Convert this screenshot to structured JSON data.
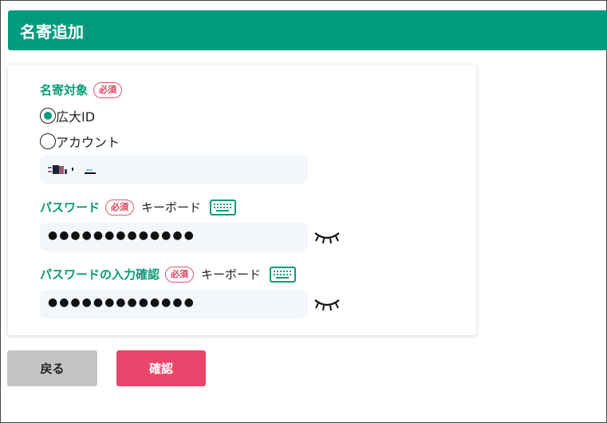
{
  "header": {
    "title": "名寄追加"
  },
  "target": {
    "label": "名寄対象",
    "required": "必須",
    "options": [
      {
        "label": "広大ID",
        "checked": true
      },
      {
        "label": "アカウント",
        "checked": false
      }
    ]
  },
  "password": {
    "label": "パスワード",
    "required": "必須",
    "keyboard_label": "キーボード",
    "masked_value": "●●●●●●●●●●●●●"
  },
  "password_confirm": {
    "label": "パスワードの入力確認",
    "required": "必須",
    "keyboard_label": "キーボード",
    "masked_value": "●●●●●●●●●●●●●"
  },
  "buttons": {
    "back": "戻る",
    "confirm": "確認"
  },
  "colors": {
    "accent": "#009b7d",
    "required": "#e0405c",
    "confirm": "#e8466a"
  }
}
